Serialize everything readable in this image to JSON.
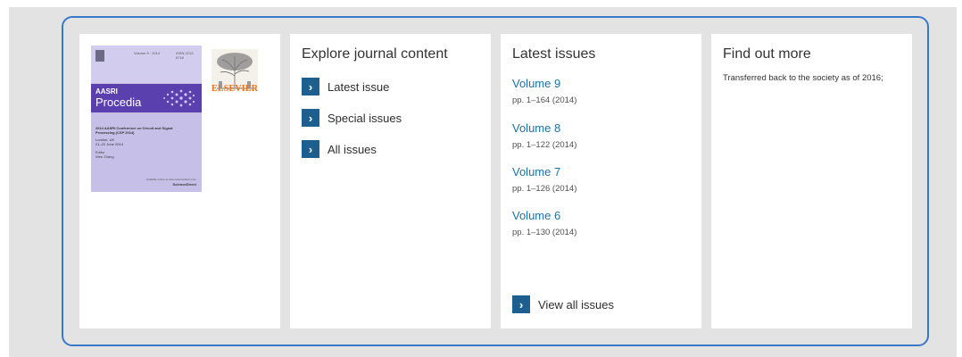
{
  "cover": {
    "small_text_1": "Volume 9 · 2014",
    "small_text_2": "ISSN 2212-6716",
    "band_line_1": "AASRI",
    "band_line_2": "Procedia",
    "conference": "2014 AASRI Conference on Circuit and Signal Processing (CSP 2014)",
    "location": "London, UK",
    "dates": "21–22 June 2014",
    "editor_label": "Editor",
    "editor": "Wen Zhang",
    "availability": "Available online at www.sciencedirect.com",
    "platform": "ScienceDirect"
  },
  "publisher": {
    "name": "ELSEVIER"
  },
  "explore": {
    "title": "Explore journal content",
    "links": [
      {
        "label": "Latest issue"
      },
      {
        "label": "Special issues"
      },
      {
        "label": "All issues"
      }
    ]
  },
  "latest": {
    "title": "Latest issues",
    "volumes": [
      {
        "name": "Volume 9",
        "pages": "pp. 1–164 (2014)"
      },
      {
        "name": "Volume 8",
        "pages": "pp. 1–122 (2014)"
      },
      {
        "name": "Volume 7",
        "pages": "pp. 1–126 (2014)"
      },
      {
        "name": "Volume 6",
        "pages": "pp. 1–130 (2014)"
      }
    ],
    "view_all": "View all issues"
  },
  "find_out": {
    "title": "Find out more",
    "text": "Transferred back to the society as of 2016;"
  },
  "colors": {
    "frame": "#3a78c9",
    "arrow_button": "#1d5f8f",
    "volume_link": "#1a73a8",
    "elsevier": "#e8731e",
    "cover_band": "#5a3fae"
  }
}
